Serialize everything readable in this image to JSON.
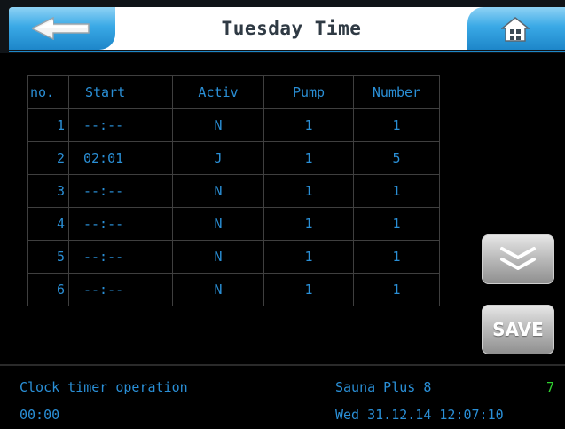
{
  "header": {
    "title": "Tuesday Time",
    "back_icon": "arrow-left-icon",
    "home_icon": "home-icon"
  },
  "table": {
    "columns": [
      "no.",
      "Start",
      "Activ",
      "Pump",
      "Number"
    ],
    "rows": [
      {
        "no": "1",
        "start": "--:--",
        "activ": "N",
        "pump": "1",
        "number": "1"
      },
      {
        "no": "2",
        "start": "02:01",
        "activ": "J",
        "pump": "1",
        "number": "5"
      },
      {
        "no": "3",
        "start": "--:--",
        "activ": "N",
        "pump": "1",
        "number": "1"
      },
      {
        "no": "4",
        "start": "--:--",
        "activ": "N",
        "pump": "1",
        "number": "1"
      },
      {
        "no": "5",
        "start": "--:--",
        "activ": "N",
        "pump": "1",
        "number": "1"
      },
      {
        "no": "6",
        "start": "--:--",
        "activ": "N",
        "pump": "1",
        "number": "1"
      }
    ]
  },
  "buttons": {
    "scroll_down_icon": "double-chevron-down-icon",
    "save_label": "SAVE"
  },
  "status": {
    "mode": "Clock timer operation",
    "device": "Sauna Plus 8",
    "indicator": "7",
    "timer": "00:00",
    "datetime": "Wed 31.12.14 12:07:10"
  },
  "colors": {
    "text_blue": "#2a8fd6",
    "indicator_green": "#2fd02f",
    "header_button_blue": "#3aa9e6"
  }
}
